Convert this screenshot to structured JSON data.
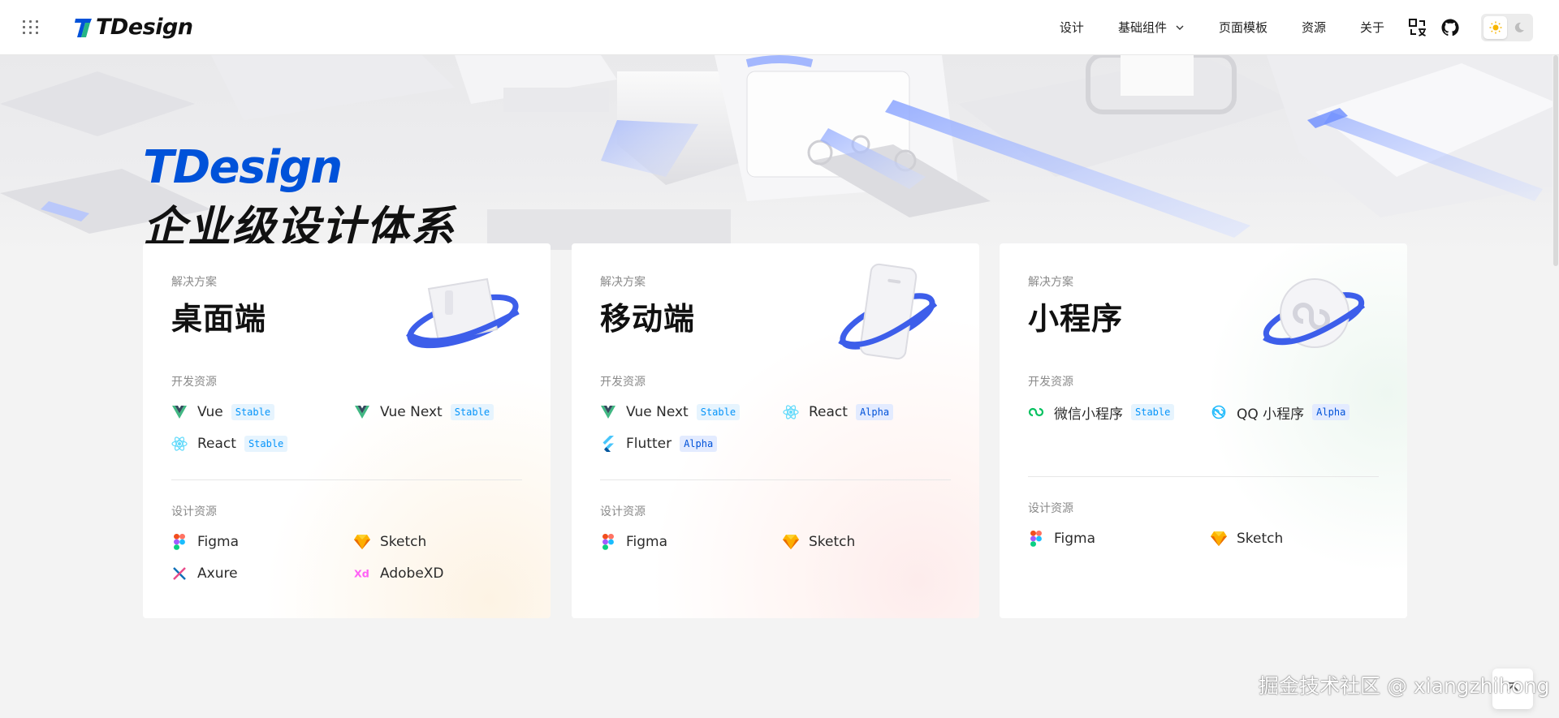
{
  "header": {
    "logo_text": "TDesign",
    "nav": [
      {
        "label": "设计"
      },
      {
        "label": "基础组件",
        "has_dropdown": true
      },
      {
        "label": "页面模板"
      },
      {
        "label": "资源"
      },
      {
        "label": "关于"
      }
    ],
    "icons": [
      "apps-grid-icon",
      "translate-icon",
      "github-icon",
      "sun-icon",
      "moon-icon"
    ],
    "theme_selected": "light"
  },
  "hero": {
    "title_en": "TDesign",
    "title_cn": "企业级设计体系"
  },
  "cards": [
    {
      "subtitle": "解决方案",
      "title": "桌面端",
      "dev_label": "开发资源",
      "dev_resources": [
        {
          "name": "Vue",
          "tag": "Stable",
          "icon": "vue-icon"
        },
        {
          "name": "Vue Next",
          "tag": "Stable",
          "icon": "vue-icon"
        },
        {
          "name": "React",
          "tag": "Stable",
          "icon": "react-icon"
        }
      ],
      "design_label": "设计资源",
      "design_resources": [
        {
          "name": "Figma",
          "icon": "figma-icon"
        },
        {
          "name": "Sketch",
          "icon": "sketch-icon"
        },
        {
          "name": "Axure",
          "icon": "axure-icon"
        },
        {
          "name": "AdobeXD",
          "icon": "adobexd-icon"
        }
      ]
    },
    {
      "subtitle": "解决方案",
      "title": "移动端",
      "dev_label": "开发资源",
      "dev_resources": [
        {
          "name": "Vue Next",
          "tag": "Stable",
          "icon": "vue-icon"
        },
        {
          "name": "React",
          "tag": "Alpha",
          "icon": "react-icon"
        },
        {
          "name": "Flutter",
          "tag": "Alpha",
          "icon": "flutter-icon"
        }
      ],
      "design_label": "设计资源",
      "design_resources": [
        {
          "name": "Figma",
          "icon": "figma-icon"
        },
        {
          "name": "Sketch",
          "icon": "sketch-icon"
        }
      ]
    },
    {
      "subtitle": "解决方案",
      "title": "小程序",
      "dev_label": "开发资源",
      "dev_resources": [
        {
          "name": "微信小程序",
          "tag": "Stable",
          "icon": "wechat-miniprogram-icon"
        },
        {
          "name": "QQ 小程序",
          "tag": "Alpha",
          "icon": "qq-miniprogram-icon"
        }
      ],
      "design_label": "设计资源",
      "design_resources": [
        {
          "name": "Figma",
          "icon": "figma-icon"
        },
        {
          "name": "Sketch",
          "icon": "sketch-icon"
        }
      ]
    }
  ],
  "watermark": "掘金技术社区 @ xiangzhihong",
  "colors": {
    "brand": "#0052d9",
    "stable_tag": "#0594fa",
    "vue": "#41b883",
    "react": "#61dafb"
  }
}
